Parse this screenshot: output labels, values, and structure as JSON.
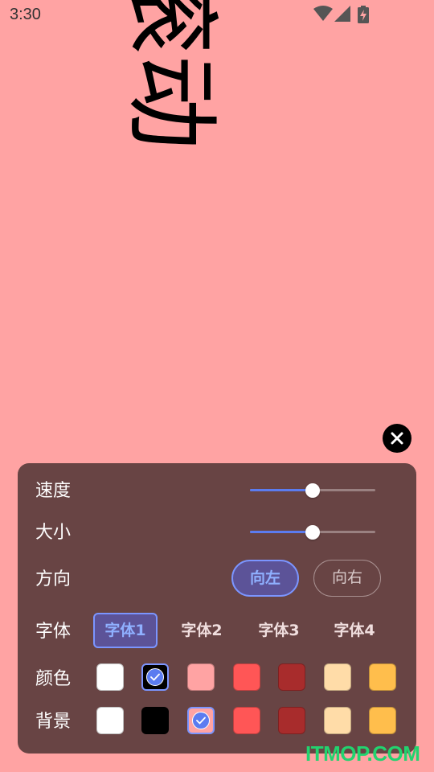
{
  "status_bar": {
    "time": "3:30",
    "icons": [
      "wifi-icon",
      "signal-icon",
      "battery-charging-icon"
    ]
  },
  "marquee": {
    "text": "滚动"
  },
  "colors": {
    "background": "#FFA3A3",
    "panel": "#684444",
    "accent": "#5b7cf0",
    "active_fill": "#5c5398"
  },
  "panel": {
    "speed": {
      "label": "速度",
      "value": 0.5
    },
    "size": {
      "label": "大小",
      "value": 0.5
    },
    "direction": {
      "label": "方向",
      "options": [
        "向左",
        "向右"
      ],
      "selected": "向左"
    },
    "font": {
      "label": "字体",
      "options": [
        "字体1",
        "字体2",
        "字体3",
        "字体4"
      ],
      "selected": "字体1"
    },
    "text_color": {
      "label": "颜色",
      "swatches": [
        "#FFFFFF",
        "#000000",
        "#FFA3A3",
        "#FF5656",
        "#A82C2C",
        "#FFDCA8",
        "#FFBE4C"
      ],
      "selected_index": 1
    },
    "background_color": {
      "label": "背景",
      "swatches": [
        "#FFFFFF",
        "#000000",
        "#FFA3A3",
        "#FF5656",
        "#A82C2C",
        "#FFDCA8",
        "#FFBE4C"
      ],
      "selected_index": 2
    }
  },
  "watermark": "ITMOP.COM"
}
